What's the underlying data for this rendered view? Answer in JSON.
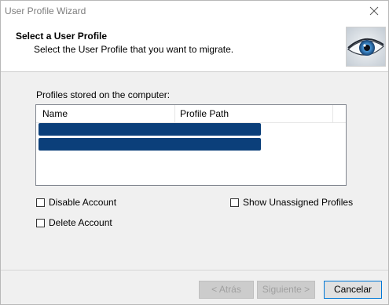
{
  "window": {
    "title": "User Profile Wizard"
  },
  "header": {
    "title": "Select a User Profile",
    "subtitle": "Select the User Profile that you want to migrate.",
    "image_icon": "eye-graphic"
  },
  "profiles": {
    "label": "Profiles stored on the computer:",
    "columns": [
      "Name",
      "Profile Path"
    ],
    "rows": [
      {
        "name": "",
        "path": ""
      },
      {
        "name": "",
        "path": ""
      }
    ]
  },
  "options": {
    "disable_account": {
      "label": "Disable Account",
      "checked": false
    },
    "delete_account": {
      "label": "Delete Account",
      "checked": false
    },
    "show_unassigned": {
      "label": "Show Unassigned Profiles",
      "checked": false
    }
  },
  "buttons": {
    "back": "< Atrás",
    "next": "Siguiente >",
    "cancel": "Cancelar"
  },
  "colors": {
    "selection": "#0b3f7a",
    "primary_border": "#0078d7"
  }
}
